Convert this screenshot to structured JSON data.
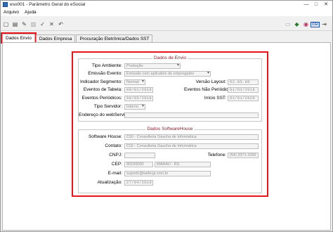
{
  "window": {
    "title": "eso001 - Parâmetro Geral do eSocial",
    "controls": [
      "—",
      "□",
      "✕"
    ]
  },
  "menu": [
    "Arquivo",
    "Ajuda"
  ],
  "tabs": [
    "Dados Envio",
    "Dados Empresa",
    "Procuração Eletrônica/Dados SST"
  ],
  "envio": {
    "title": "Dados de Envio",
    "tipo_ambiente": {
      "label": "Tipo Ambiente:",
      "value": "Produção"
    },
    "emissao_evento": {
      "label": "Emissão Evento:",
      "value": "Emissão com aplicativo do empregador"
    },
    "indicador_segmento": {
      "label": "Indicador Segmento:",
      "value": "Normal"
    },
    "versao_layout": {
      "label": "Versão Layout:",
      "value": "02.05.00"
    },
    "eventos_tabela": {
      "label": "Eventos de Tabela:",
      "value": "08/01/2018"
    },
    "eventos_nao_periodicos": {
      "label": "Eventos Não Periódicos:",
      "value": "01/03/2018"
    },
    "eventos_periodicos": {
      "label": "Eventos Periódicos:",
      "value": "08/05/2018"
    },
    "inicio_sst": {
      "label": "Início SST:",
      "value": "01/01/2020"
    },
    "tipo_servidor": {
      "label": "Tipo Servidor:",
      "value": "Interno"
    },
    "endereco_webservice": {
      "label": "Endereço do webService:",
      "value": ""
    }
  },
  "software_house": {
    "title": "Dados SoftwareHouse",
    "software_house": {
      "label": "Software House:",
      "value": "CGI - Consultoria Gaucha de Informática"
    },
    "contato": {
      "label": "Contato:",
      "value": "CGI - Consultoria Gaucha de Informática"
    },
    "cnpj": {
      "label": "CNPJ:",
      "value": ""
    },
    "telefone": {
      "label": "Telefone:",
      "value": "(54) 3371-1050"
    },
    "cep": {
      "label": "CEP:",
      "value": "99150000"
    },
    "cidade": {
      "value": "MARAU - RS"
    },
    "email": {
      "label": "E-mail:",
      "value": "suporte@webcgi.com.br"
    },
    "atualizacao": {
      "label": "Atualização:",
      "value": "27/04/2019"
    }
  },
  "colors": {
    "highlight": "#e8141a",
    "group_title": "#7a1e2a"
  }
}
